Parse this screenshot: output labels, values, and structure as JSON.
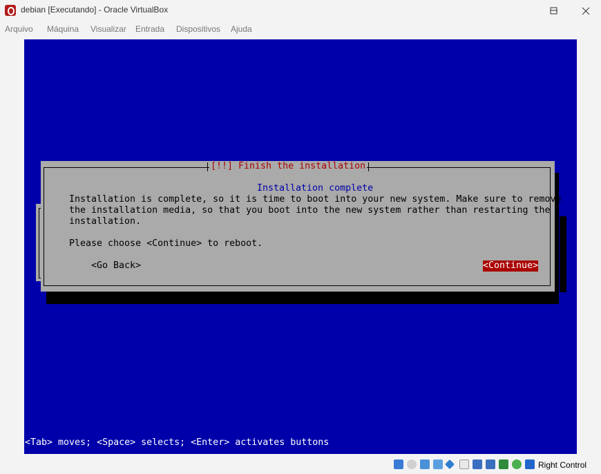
{
  "window": {
    "title": "debian [Executando] - Oracle VirtualBox",
    "minimize": "minimize",
    "maximize": "maximize",
    "close": "close"
  },
  "menu": {
    "items": [
      "Arquivo",
      "Máquina",
      "Visualizar",
      "Entrada",
      "Dispositivos",
      "Ajuda"
    ]
  },
  "installer": {
    "dialog_title": "[!!] Finish the installation",
    "subtitle": "Installation complete",
    "body_lines": [
      "Installation is complete, so it is time to boot into your new system. Make sure to remove",
      "the installation media, so that you boot into the new system rather than restarting the",
      "installation."
    ],
    "prompt": "Please choose <Continue> to reboot.",
    "go_back": "<Go Back>",
    "continue": "<Continue>",
    "hint": "<Tab> moves; <Space> selects; <Enter> activates buttons",
    "colors": {
      "screen": "#0000aa",
      "dialog": "#aaaaaa",
      "title": "#aa0000",
      "subtitle": "#0000aa",
      "selected": "#aa0000"
    }
  },
  "status": {
    "host_key": "Right Control",
    "icons": [
      "hard-disk-icon",
      "optical-drive-icon",
      "audio-icon",
      "network-icon",
      "usb-icon",
      "shared-folders-icon",
      "display-icon",
      "recording-icon",
      "cpu-icon",
      "mouse-integration-icon",
      "keyboard-capture-icon"
    ]
  }
}
